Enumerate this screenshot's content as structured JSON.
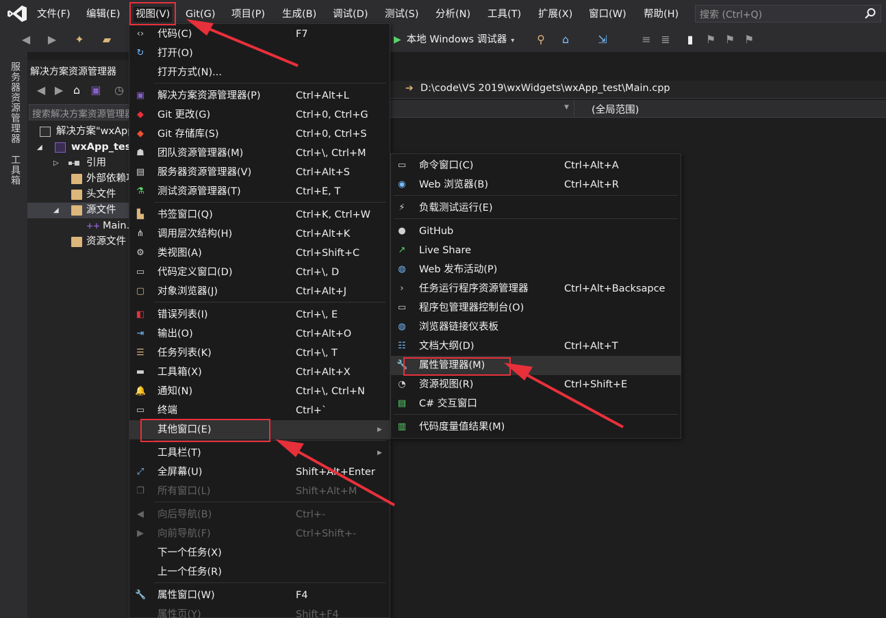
{
  "menubar": {
    "items": [
      "文件(F)",
      "编辑(E)",
      "视图(V)",
      "Git(G)",
      "项目(P)",
      "生成(B)",
      "调试(D)",
      "测试(S)",
      "分析(N)",
      "工具(T)",
      "扩展(X)",
      "窗口(W)",
      "帮助(H)"
    ],
    "search_placeholder": "搜索 (Ctrl+Q)"
  },
  "toolbar": {
    "debugger_label": "本地 Windows 调试器"
  },
  "side_tabs": [
    "服务器资源管理器",
    "工具箱"
  ],
  "solution_explorer": {
    "title": "解决方案资源管理器",
    "search_placeholder": "搜索解决方案资源管理器",
    "tree": [
      {
        "label": "解决方案\"wxApp_test\"",
        "bold": false
      },
      {
        "label": "wxApp_test",
        "bold": true
      },
      {
        "label": "引用",
        "bold": false
      },
      {
        "label": "外部依赖项",
        "bold": false
      },
      {
        "label": "头文件",
        "bold": false
      },
      {
        "label": "源文件",
        "bold": false
      },
      {
        "label": "Main.cpp",
        "bold": false
      },
      {
        "label": "资源文件",
        "bold": false
      }
    ]
  },
  "editor": {
    "path": "D:\\code\\VS 2019\\wxWidgets\\wxApp_test\\Main.cpp",
    "scope": "(全局范围)"
  },
  "view_menu": {
    "items": [
      {
        "label": "代码(C)",
        "key": "F7",
        "icon": "code-icon",
        "disabled": false
      },
      {
        "label": "打开(O)",
        "key": "",
        "icon": "open-icon",
        "disabled": false
      },
      {
        "label": "打开方式(N)...",
        "key": "",
        "icon": "",
        "disabled": false
      },
      {
        "label": "解决方案资源管理器(P)",
        "key": "Ctrl+Alt+L",
        "icon": "solution-explorer-icon",
        "disabled": false
      },
      {
        "label": "Git 更改(G)",
        "key": "Ctrl+0, Ctrl+G",
        "icon": "git-changes-icon",
        "disabled": false
      },
      {
        "label": "Git 存储库(S)",
        "key": "Ctrl+0, Ctrl+S",
        "icon": "git-repo-icon",
        "disabled": false
      },
      {
        "label": "团队资源管理器(M)",
        "key": "Ctrl+\\, Ctrl+M",
        "icon": "team-explorer-icon",
        "disabled": false
      },
      {
        "label": "服务器资源管理器(V)",
        "key": "Ctrl+Alt+S",
        "icon": "server-explorer-icon",
        "disabled": false
      },
      {
        "label": "测试资源管理器(T)",
        "key": "Ctrl+E, T",
        "icon": "test-explorer-icon",
        "disabled": false
      },
      {
        "label": "书签窗口(Q)",
        "key": "Ctrl+K, Ctrl+W",
        "icon": "bookmark-window-icon",
        "disabled": false
      },
      {
        "label": "调用层次结构(H)",
        "key": "Ctrl+Alt+K",
        "icon": "call-hierarchy-icon",
        "disabled": false
      },
      {
        "label": "类视图(A)",
        "key": "Ctrl+Shift+C",
        "icon": "class-view-icon",
        "disabled": false
      },
      {
        "label": "代码定义窗口(D)",
        "key": "Ctrl+\\, D",
        "icon": "code-definition-icon",
        "disabled": false
      },
      {
        "label": "对象浏览器(J)",
        "key": "Ctrl+Alt+J",
        "icon": "object-browser-icon",
        "disabled": false
      },
      {
        "label": "错误列表(I)",
        "key": "Ctrl+\\, E",
        "icon": "error-list-icon",
        "disabled": false
      },
      {
        "label": "输出(O)",
        "key": "Ctrl+Alt+O",
        "icon": "output-icon",
        "disabled": false
      },
      {
        "label": "任务列表(K)",
        "key": "Ctrl+\\, T",
        "icon": "task-list-icon",
        "disabled": false
      },
      {
        "label": "工具箱(X)",
        "key": "Ctrl+Alt+X",
        "icon": "toolbox-icon",
        "disabled": false
      },
      {
        "label": "通知(N)",
        "key": "Ctrl+\\, Ctrl+N",
        "icon": "notification-bell-icon",
        "disabled": false
      },
      {
        "label": "终端",
        "key": "Ctrl+`",
        "icon": "terminal-icon",
        "disabled": false
      },
      {
        "label": "其他窗口(E)",
        "key": "",
        "icon": "",
        "disabled": false
      },
      {
        "label": "工具栏(T)",
        "key": "",
        "icon": "",
        "disabled": false
      },
      {
        "label": "全屏幕(U)",
        "key": "Shift+Alt+Enter",
        "icon": "fullscreen-icon",
        "disabled": false
      },
      {
        "label": "所有窗口(L)",
        "key": "Shift+Alt+M",
        "icon": "all-windows-icon",
        "disabled": true
      },
      {
        "label": "向后导航(B)",
        "key": "Ctrl+-",
        "icon": "navigate-back-icon",
        "disabled": true
      },
      {
        "label": "向前导航(F)",
        "key": "Ctrl+Shift+-",
        "icon": "navigate-forward-icon",
        "disabled": true
      },
      {
        "label": "下一个任务(X)",
        "key": "",
        "icon": "",
        "disabled": false
      },
      {
        "label": "上一个任务(R)",
        "key": "",
        "icon": "",
        "disabled": false
      },
      {
        "label": "属性窗口(W)",
        "key": "F4",
        "icon": "wrench-icon",
        "disabled": false
      },
      {
        "label": "属性页(Y)",
        "key": "Shift+F4",
        "icon": "",
        "disabled": true
      }
    ]
  },
  "other_windows_menu": {
    "items": [
      {
        "label": "命令窗口(C)",
        "key": "Ctrl+Alt+A",
        "icon": "command-window-icon"
      },
      {
        "label": "Web 浏览器(B)",
        "key": "Ctrl+Alt+R",
        "icon": "web-browser-icon"
      },
      {
        "label": "负载测试运行(E)",
        "key": "",
        "icon": "load-test-icon"
      },
      {
        "label": "GitHub",
        "key": "",
        "icon": "github-icon"
      },
      {
        "label": "Live Share",
        "key": "",
        "icon": "live-share-icon"
      },
      {
        "label": "Web 发布活动(P)",
        "key": "",
        "icon": "web-publish-icon"
      },
      {
        "label": "任务运行程序资源管理器",
        "key": "Ctrl+Alt+Backsapce",
        "icon": "task-runner-icon"
      },
      {
        "label": "程序包管理器控制台(O)",
        "key": "",
        "icon": "package-console-icon"
      },
      {
        "label": "浏览器链接仪表板",
        "key": "",
        "icon": "browser-link-icon"
      },
      {
        "label": "文档大纲(D)",
        "key": "Ctrl+Alt+T",
        "icon": "document-outline-icon"
      },
      {
        "label": "属性管理器(M)",
        "key": "",
        "icon": "property-manager-wrench-icon"
      },
      {
        "label": "资源视图(R)",
        "key": "Ctrl+Shift+E",
        "icon": "resource-view-icon"
      },
      {
        "label": "C# 交互窗口",
        "key": "",
        "icon": "csharp-interactive-icon"
      },
      {
        "label": "代码度量值结果(M)",
        "key": "",
        "icon": "code-metrics-icon"
      }
    ]
  },
  "colors": {
    "accent_red": "#e8303a",
    "menu_bg": "#1b1b1c",
    "chrome_bg": "#2d2d30",
    "vs_purple": "#865fc5"
  }
}
